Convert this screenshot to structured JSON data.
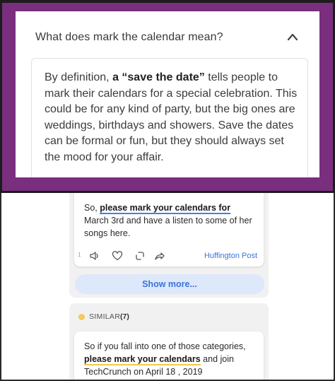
{
  "faq": {
    "question": "What does mark the calendar mean?",
    "answer_pre": "By definition, ",
    "answer_bold": "a “save the date”",
    "answer_post": " tells people to mark their calendars for a special celebration. This could be for any kind of party, but the big ones are weddings, birthdays and showers. Save the dates can be formal or fun, but they should always set the mood for your affair."
  },
  "examples": {
    "first": {
      "pre": "So, ",
      "highlight": "please mark your calendars for",
      "post": " March 3rd and have a listen to some of her songs here.",
      "count": "1",
      "source": "Huffington Post"
    },
    "show_more": "Show more...",
    "similar": {
      "label": "SIMILAR",
      "count": "(7)",
      "dot_color": "#f4c95d"
    },
    "second": {
      "pre": "So if you fall into one of those categories, ",
      "highlight": "please mark your calendars",
      "post": " and join TechCrunch on April 18 , 2019"
    }
  },
  "colors": {
    "frame_purple": "#7a2e7e",
    "link_blue": "#3b73d9",
    "highlight_blue": "#3b82f6",
    "highlight_yellow": "#f2c94c"
  }
}
